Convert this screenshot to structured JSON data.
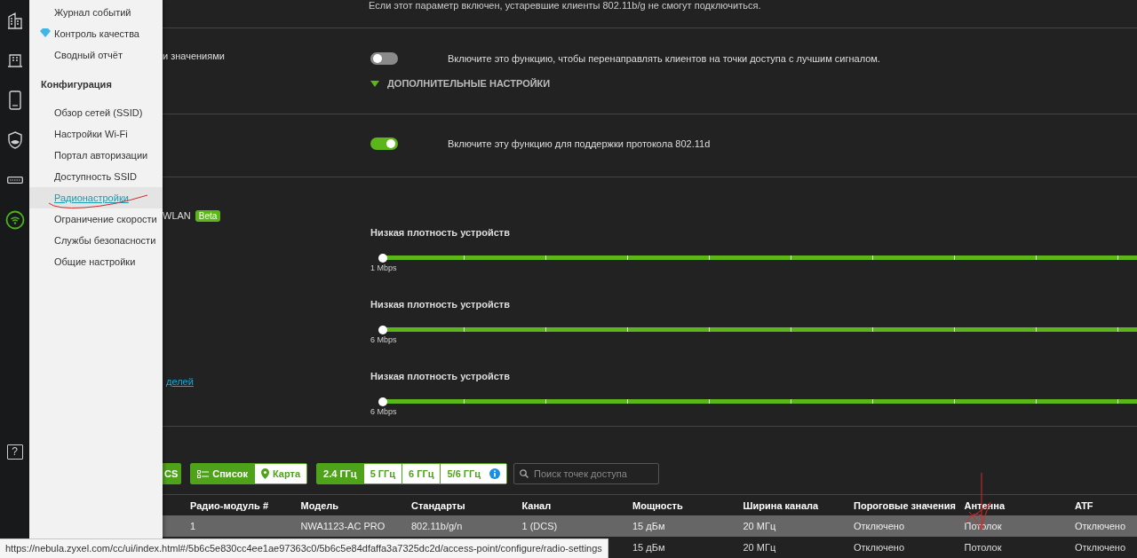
{
  "rail": {
    "items": [
      {
        "selected": false
      },
      {
        "selected": false
      },
      {
        "selected": false
      },
      {
        "selected": false
      },
      {
        "selected": false
      },
      {
        "selected": true
      }
    ],
    "help": "?"
  },
  "menu": {
    "items": [
      {
        "kind": "link",
        "label": "Журнал событий",
        "selected": false
      },
      {
        "kind": "gem",
        "label": "Контроль качества",
        "selected": false
      },
      {
        "kind": "link",
        "label": "Сводный отчёт",
        "selected": false
      },
      {
        "kind": "header",
        "label": "Конфигурация"
      },
      {
        "kind": "link",
        "label": "Обзор сетей (SSID)",
        "selected": false
      },
      {
        "kind": "link",
        "label": "Настройки Wi-Fi",
        "selected": false
      },
      {
        "kind": "link",
        "label": "Портал авторизации",
        "selected": false
      },
      {
        "kind": "link",
        "label": "Доступность SSID",
        "selected": false
      },
      {
        "kind": "link",
        "label": "Радионастройки",
        "selected": true
      },
      {
        "kind": "link",
        "label": "Ограничение скорости",
        "selected": false
      },
      {
        "kind": "link",
        "label": "Службы безопасности",
        "selected": false
      },
      {
        "kind": "link",
        "label": "Общие настройки",
        "selected": false
      }
    ]
  },
  "top_notice": "Если этот параметр включен, устаревшие клиенты 802.11b/g не смогут подключиться.",
  "settings": [
    {
      "label": "и значениями",
      "on": false,
      "description": "Включите это функцию, чтобы перенаправлять клиентов на точки доступа с лучшим сигналом.",
      "advanced": "ДОПОЛНИТЕЛЬНЫЕ НАСТРОЙКИ"
    },
    {
      "on": true,
      "description": "Включите эту функцию для поддержки протокола 802.11d"
    }
  ],
  "wlan": {
    "label": "WLAN",
    "badge": "Beta",
    "sliders": [
      {
        "title": "Низкая плотность устройств",
        "level": 0,
        "reading": "1 Mbps"
      },
      {
        "title": "Низкая плотность устройств",
        "level": 0,
        "reading": "6 Mbps"
      },
      {
        "link": "делей",
        "title": "Низкая плотность устройств",
        "level": 0,
        "reading": "6 Mbps"
      }
    ]
  },
  "toolbar": {
    "action_button": "CS",
    "views": [
      {
        "label": "Список",
        "selected": true
      },
      {
        "label": "Карта",
        "selected": false
      }
    ],
    "bands": [
      {
        "label": "2.4 ГГц",
        "selected": true,
        "info": false
      },
      {
        "label": "5 ГГц",
        "selected": false,
        "info": false
      },
      {
        "label": "6 ГГц",
        "selected": false,
        "info": false
      },
      {
        "label": "5/6 ГГц",
        "selected": false,
        "info": true
      }
    ],
    "search": {
      "placeholder": "Поиск точек доступа"
    }
  },
  "table": {
    "columns": [
      "Радио-модуль #",
      "Модель",
      "Стандарты",
      "Канал",
      "Мощность",
      "Ширина канала",
      "Пороговые значения",
      "Антенна",
      "ATF"
    ],
    "rows": [
      {
        "selected": true,
        "cells": [
          "1",
          "NWA1123-AC PRO",
          "802.11b/g/n",
          "1 (DCS)",
          "15 дБм",
          "20 МГц",
          "Отключено",
          "Потолок",
          "Отключено"
        ]
      },
      {
        "selected": false,
        "cells": [
          "",
          "",
          "",
          "",
          "15 дБм",
          "20 МГц",
          "Отключено",
          "Потолок",
          "Отключено"
        ]
      }
    ]
  },
  "status_url": "https://nebula.zyxel.com/cc/ui/index.html#/5b6c5e830cc4ee1ae97363c0/5b6c5e84dfaffa3a7325dc2d/access-point/configure/radio-settings"
}
